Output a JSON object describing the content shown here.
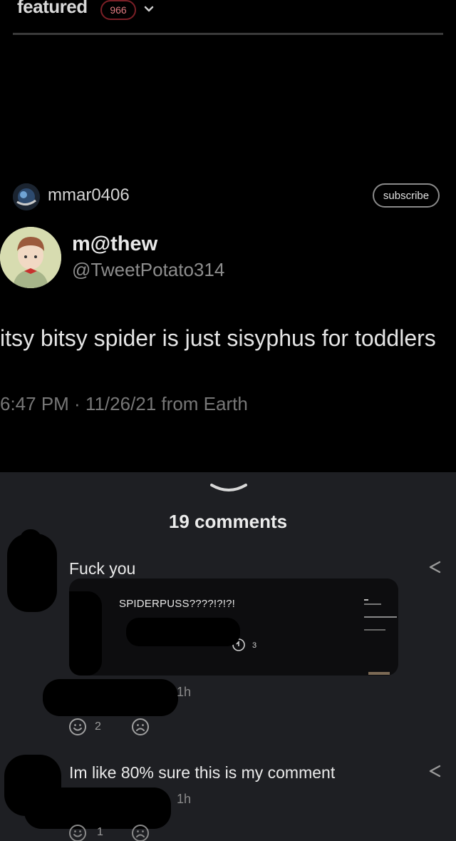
{
  "topbar": {
    "title": "featured",
    "badge_count": "966"
  },
  "post": {
    "author": "mmar0406",
    "subscribe_label": "subscribe"
  },
  "tweet": {
    "display_name": "m@thew",
    "handle": "@TweetPotato314",
    "text": "itsy bitsy spider is just sisyphus for toddlers",
    "meta": "6:47 PM · 11/26/21 from Earth"
  },
  "comments_section": {
    "count_label": "19 comments",
    "comments": [
      {
        "text": "Fuck you",
        "embed": {
          "caption": "SPIDERPUSS????!?!?!",
          "reply_count": "3"
        },
        "time": "1h",
        "happy_count": "2",
        "sad_count": ""
      },
      {
        "text": "Im like 80% sure this is my comment",
        "time": "1h",
        "happy_count": "1",
        "sad_count": ""
      }
    ]
  },
  "colors": {
    "background": "#000000",
    "panel": "#1e1f23",
    "badge_border": "#7a1f26",
    "muted_text": "#8d8d8d"
  },
  "icons": [
    "chevron-down-icon",
    "share-icon",
    "smiley-happy-icon",
    "smiley-sad-icon",
    "reply-icon"
  ]
}
